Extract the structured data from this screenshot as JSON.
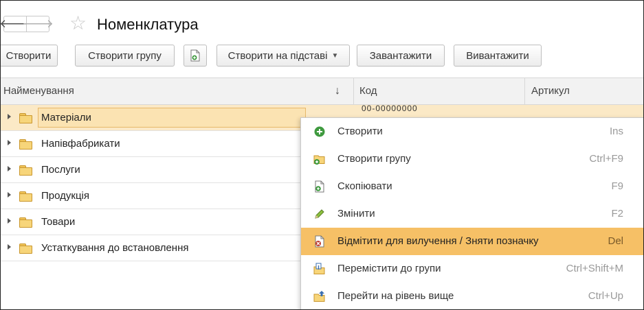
{
  "header": {
    "back_glyph": "🡐",
    "forward_glyph": "🡒",
    "star_glyph": "☆",
    "title": "Номенклатура"
  },
  "toolbar": {
    "create": "Створити",
    "create_group": "Створити групу",
    "create_based_on": "Створити на підставі",
    "load": "Завантажити",
    "unload": "Вивантажити"
  },
  "table": {
    "columns": {
      "name": "Найменування",
      "sort_glyph": "↓",
      "code": "Код",
      "article": "Артикул"
    },
    "rows": [
      {
        "label": "Матеріали",
        "code_partial": "00-00000000"
      },
      {
        "label": "Напівфабрикати"
      },
      {
        "label": "Послуги"
      },
      {
        "label": "Продукція"
      },
      {
        "label": "Товари"
      },
      {
        "label": "Устаткування до встановлення"
      }
    ]
  },
  "context_menu": {
    "items": [
      {
        "label": "Створити",
        "shortcut": "Ins",
        "icon": "plus-circle-icon"
      },
      {
        "label": "Створити групу",
        "shortcut": "Ctrl+F9",
        "icon": "new-folder-icon"
      },
      {
        "label": "Скопіювати",
        "shortcut": "F9",
        "icon": "copy-document-icon"
      },
      {
        "label": "Змінити",
        "shortcut": "F2",
        "icon": "pencil-icon"
      },
      {
        "label": "Відмітити для вилучення / Зняти позначку",
        "shortcut": "Del",
        "icon": "mark-delete-icon"
      },
      {
        "label": "Перемістити до групи",
        "shortcut": "Ctrl+Shift+M",
        "icon": "move-to-group-icon"
      },
      {
        "label": "Перейти на рівень вище",
        "shortcut": "Ctrl+Up",
        "icon": "level-up-icon"
      }
    ]
  },
  "colors": {
    "highlight": "#f6c066",
    "selected_row": "#fbe9c6",
    "header_bg": "#f2f2f2"
  }
}
